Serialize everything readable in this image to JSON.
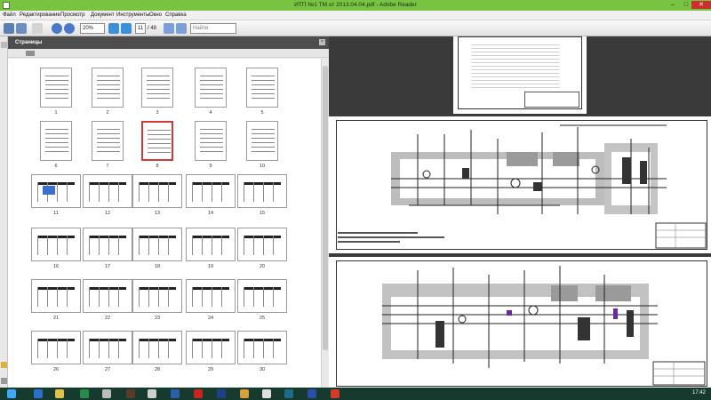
{
  "window": {
    "title": "ИТП №1 ТМ от 2013.04.04.pdf - Adobe Reader",
    "controls": [
      "–",
      "□",
      "✕"
    ]
  },
  "menu": [
    "Файл",
    "Редактирование",
    "Просмотр",
    "Документ",
    "Инструменты",
    "Окно",
    "Справка"
  ],
  "toolbar": {
    "zoom_value": "20%",
    "page_current": "11",
    "page_total": "/ 48",
    "find_placeholder": "Найти"
  },
  "panel": {
    "title": "Страницы",
    "thumb_labels": [
      "1",
      "2",
      "3",
      "4",
      "5",
      "6",
      "7",
      "8",
      "9",
      "10",
      "11",
      "12",
      "13",
      "14",
      "15",
      "16",
      "17",
      "18",
      "19",
      "20",
      "21",
      "22",
      "23",
      "24",
      "25",
      "26",
      "27",
      "28",
      "29",
      "30"
    ],
    "selected_page": "8"
  },
  "taskbar": {
    "clock": "17:42"
  },
  "colors": {
    "titlebar": "#78c442",
    "taskbar": "#173a2f",
    "selection": "#d13a3a"
  }
}
